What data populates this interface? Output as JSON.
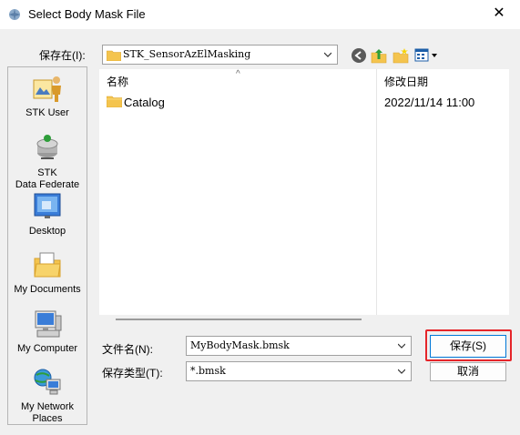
{
  "window": {
    "title": "Select Body Mask File",
    "close_glyph": "✕"
  },
  "location": {
    "label": "保存在(I):",
    "value": "STK_SensorAzElMasking"
  },
  "toolbar": {
    "icons": [
      "back-icon",
      "up-folder-icon",
      "new-folder-icon",
      "view-menu-icon"
    ]
  },
  "places": [
    {
      "label": "STK User",
      "icon": "user-folder-icon"
    },
    {
      "label": "STK\nData Federate",
      "icon": "data-federate-icon"
    },
    {
      "label": "Desktop",
      "icon": "desktop-icon"
    },
    {
      "label": "My Documents",
      "icon": "documents-icon"
    },
    {
      "label": "My Computer",
      "icon": "computer-icon"
    },
    {
      "label": "My Network\nPlaces",
      "icon": "network-icon"
    }
  ],
  "filelist": {
    "columns": [
      "名称",
      "修改日期"
    ],
    "sort_glyph": "^",
    "rows": [
      {
        "name": "Catalog",
        "date": "2022/11/14 11:00",
        "icon": "folder-icon"
      }
    ]
  },
  "filename": {
    "label": "文件名(N):",
    "value": "MyBodyMask.bmsk"
  },
  "filetype": {
    "label": "保存类型(T):",
    "value": "*.bmsk"
  },
  "buttons": {
    "save": "保存(S)",
    "cancel": "取消"
  },
  "colors": {
    "folder": "#f4c44e",
    "accent": "#0078d7",
    "highlight": "#e5252a"
  }
}
